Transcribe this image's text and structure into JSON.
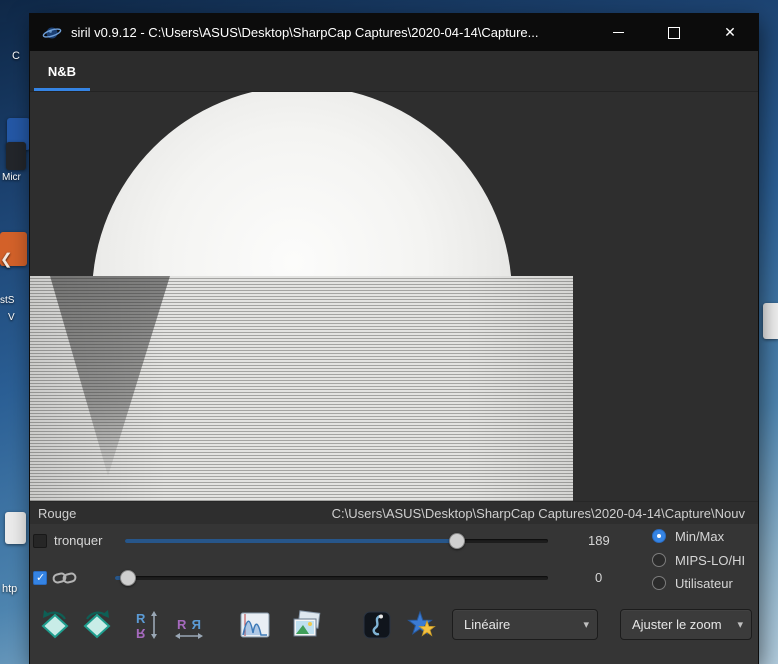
{
  "desktop": {
    "fragments": {
      "top_c": "C",
      "micr": "Micr",
      "sts": "stS",
      "v": "V",
      "htp": "htp"
    }
  },
  "window": {
    "title": "siril v0.9.12 - C:\\Users\\ASUS\\Desktop\\SharpCap Captures\\2020-04-14\\Capture...",
    "close_glyph": "✕"
  },
  "tab": {
    "label": "N&B"
  },
  "statusbar": {
    "channel": "Rouge",
    "path": "C:\\Users\\ASUS\\Desktop\\SharpCap Captures\\2020-04-14\\Capture\\Nouv"
  },
  "stretch": {
    "truncate_label": "tronquer",
    "high_value": "189",
    "low_value": "0",
    "modes": [
      {
        "label": "Min/Max",
        "selected": true
      },
      {
        "label": "MIPS-LO/HI",
        "selected": false
      },
      {
        "label": "Utilisateur",
        "selected": false
      }
    ]
  },
  "toolbar": {
    "display_mode": "Linéaire",
    "zoom": "Ajuster le zoom",
    "dropdown_arrow": "▾",
    "icons": [
      "rotate-left",
      "rotate-right",
      "flip-vertical",
      "flip-horizontal",
      "histogram",
      "image-stack",
      "processing",
      "psf-star"
    ]
  },
  "colors": {
    "accent": "#3584e4",
    "titlebar": "#0c0c0c",
    "panel": "#353535",
    "canvas": "#2e2e2e",
    "desktop_blue": "#2b5f95",
    "slider_fill": "#27568a"
  }
}
